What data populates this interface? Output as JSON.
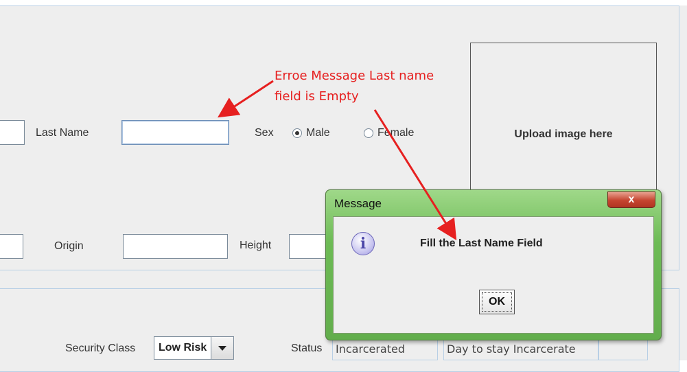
{
  "form": {
    "last_name_label": "Last Name",
    "sex_label": "Sex",
    "sex_options": [
      "Male",
      "Female"
    ],
    "sex_selected": "Male",
    "origin_label": "Origin",
    "height_label": "Height",
    "upload_label": "Upload image here",
    "security_class_label": "Security Class",
    "security_class_value": "Low Risk",
    "status_label": "Status",
    "status_value": "Incarcerated",
    "day_to_stay_value": "Day to stay Incarcerate"
  },
  "annotation": {
    "text": "Erroe Message Last name field is Empty",
    "color": "#e62020"
  },
  "dialog": {
    "title": "Message",
    "close_glyph": "x",
    "icon": "info-icon",
    "message": "Fill the Last Name Field",
    "ok_label": "OK"
  },
  "colors": {
    "panel_border": "#b8cfe5",
    "dialog_frame": "#6dbb55",
    "close_button": "#c5442f"
  }
}
